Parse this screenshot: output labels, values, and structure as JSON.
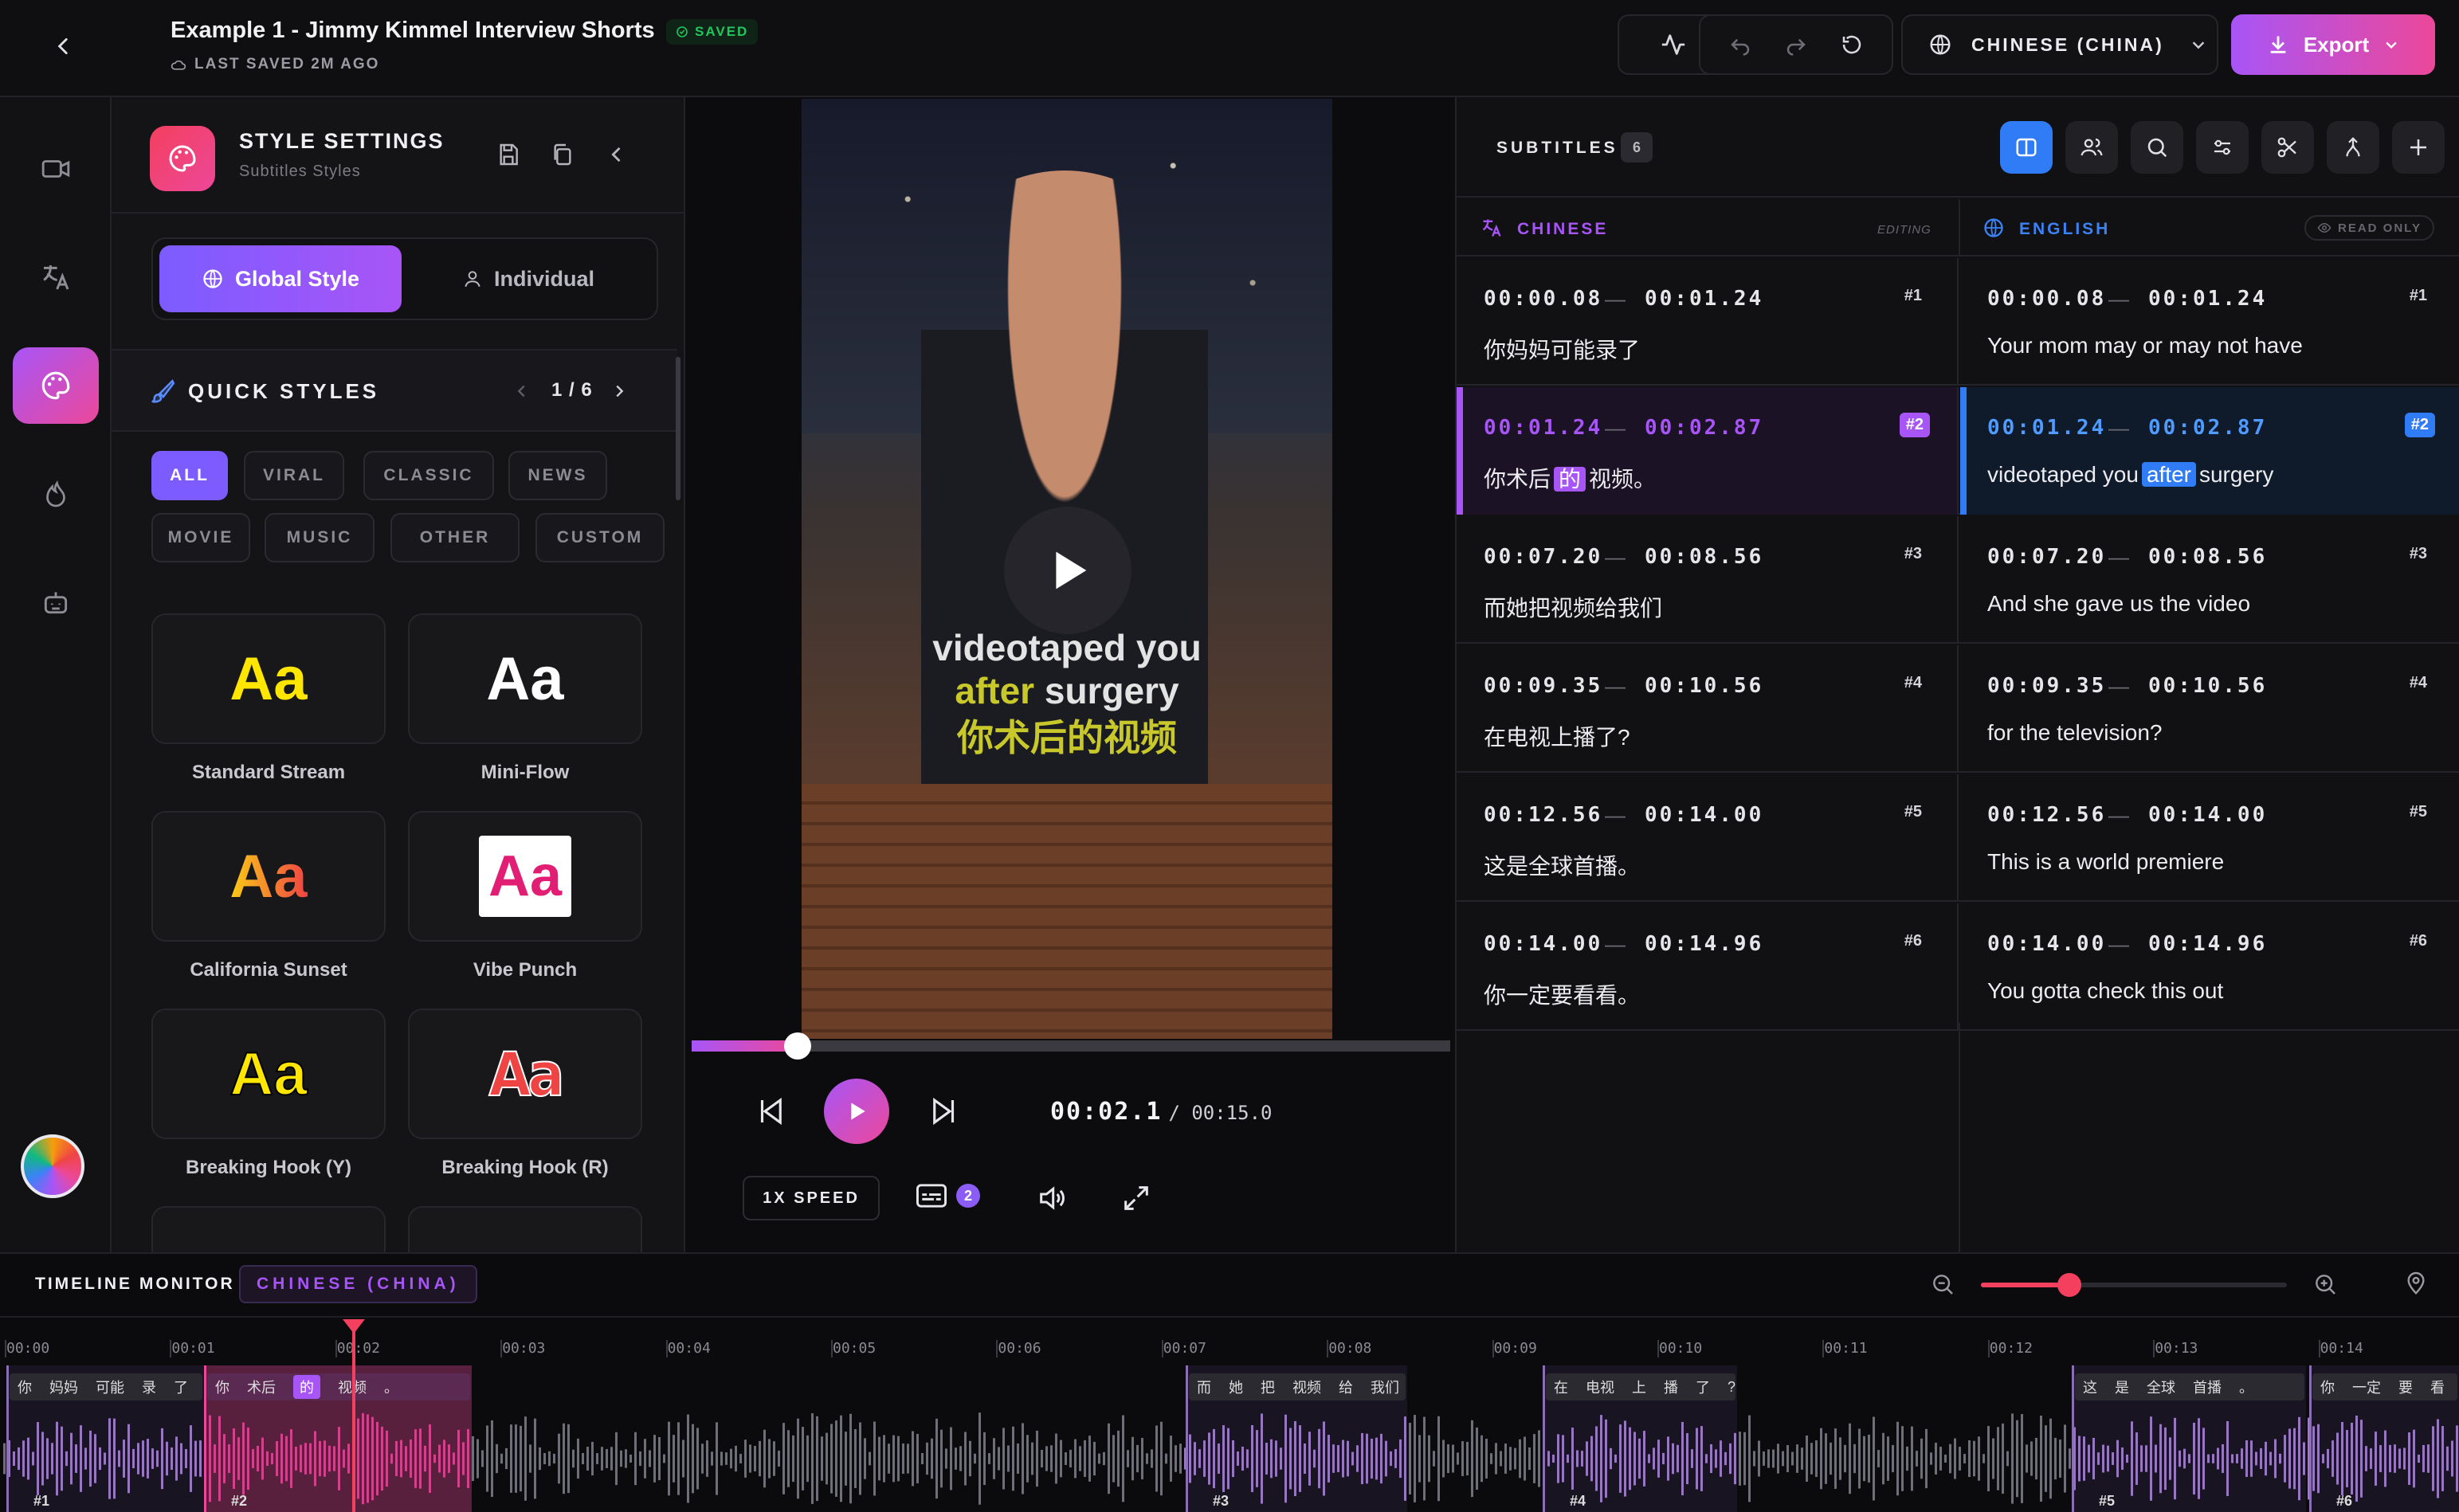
{
  "header": {
    "title": "Example 1 - Jimmy Kimmel Interview Shorts",
    "saved_badge": "SAVED",
    "last_saved": "LAST SAVED 2M AGO",
    "language": "CHINESE (CHINA)",
    "export_label": "Export"
  },
  "style_panel": {
    "title": "STYLE SETTINGS",
    "subtitle": "Subtitles Styles",
    "global_tab": "Global Style",
    "individual_tab": "Individual",
    "quick_styles_label": "QUICK STYLES",
    "pager": "1 / 6",
    "filters": [
      "ALL",
      "VIRAL",
      "CLASSIC",
      "NEWS",
      "MOVIE",
      "MUSIC",
      "OTHER",
      "CUSTOM"
    ],
    "styles": [
      {
        "name": "Standard Stream",
        "sample": "Aa"
      },
      {
        "name": "Mini-Flow",
        "sample": "Aa"
      },
      {
        "name": "California Sunset",
        "sample": "Aa"
      },
      {
        "name": "Vibe Punch",
        "sample": "Aa"
      },
      {
        "name": "Breaking Hook (Y)",
        "sample": "Aa"
      },
      {
        "name": "Breaking Hook (R)",
        "sample": "Aa"
      }
    ]
  },
  "player": {
    "caption_line1": "videotaped you",
    "caption_line2_a": "after",
    "caption_line2_b": "surgery",
    "caption_zh": "你术后的视频",
    "current_time": "00:02.1",
    "total_time": "/ 00:15.0",
    "speed": "1X SPEED",
    "subtitle_count": "2",
    "progress": 0.14
  },
  "subtitles": {
    "label": "SUBTITLES",
    "count": "6",
    "source_lang": "CHINESE",
    "source_status": "EDITING",
    "target_lang": "ENGLISH",
    "target_status": "READ ONLY",
    "rows": [
      {
        "start": "00:00.08",
        "end": "00:01.24",
        "num": "#1",
        "zh": "你妈妈可能录了",
        "en": "Your mom may or may not have"
      },
      {
        "start": "00:01.24",
        "end": "00:02.87",
        "num": "#2",
        "zh_a": "你术后",
        "zh_hl": "的",
        "zh_b": "视频。",
        "en_a": "videotaped you",
        "en_hl": "after",
        "en_b": "surgery"
      },
      {
        "start": "00:07.20",
        "end": "00:08.56",
        "num": "#3",
        "zh": "而她把视频给我们",
        "en": "And she gave us the video"
      },
      {
        "start": "00:09.35",
        "end": "00:10.56",
        "num": "#4",
        "zh": "在电视上播了?",
        "en": "for the television?"
      },
      {
        "start": "00:12.56",
        "end": "00:14.00",
        "num": "#5",
        "zh": "这是全球首播。",
        "en": "This is a world premiere"
      },
      {
        "start": "00:14.00",
        "end": "00:14.96",
        "num": "#6",
        "zh": "你一定要看看。",
        "en": "You gotta check this out"
      }
    ]
  },
  "timeline": {
    "label": "TIMELINE MONITOR",
    "language": "CHINESE (CHINA)",
    "ticks": [
      "00:00",
      "00:01",
      "00:02",
      "00:03",
      "00:04",
      "00:05",
      "00:06",
      "00:07",
      "00:08",
      "00:09",
      "00:10",
      "00:11",
      "00:12",
      "00:13",
      "00:14"
    ],
    "segments": [
      {
        "num": "#1",
        "words": [
          "你",
          "妈妈",
          "可能",
          "录",
          "了"
        ]
      },
      {
        "num": "#2",
        "words": [
          "你",
          "术后",
          "的",
          "视频",
          "。"
        ]
      },
      {
        "num": "#3",
        "words": [
          "而",
          "她",
          "把",
          "视频",
          "给",
          "我们"
        ]
      },
      {
        "num": "#4",
        "words": [
          "在",
          "电视",
          "上",
          "播",
          "了",
          "?"
        ]
      },
      {
        "num": "#5",
        "words": [
          "这",
          "是",
          "全球",
          "首播",
          "。"
        ]
      },
      {
        "num": "#6",
        "words": [
          "你",
          "一定",
          "要",
          "看",
          "看"
        ]
      }
    ]
  },
  "colors": {
    "accent": "#a855f7",
    "pink": "#ec4899",
    "blue": "#2f7cf6",
    "saved": "#22c55e"
  }
}
